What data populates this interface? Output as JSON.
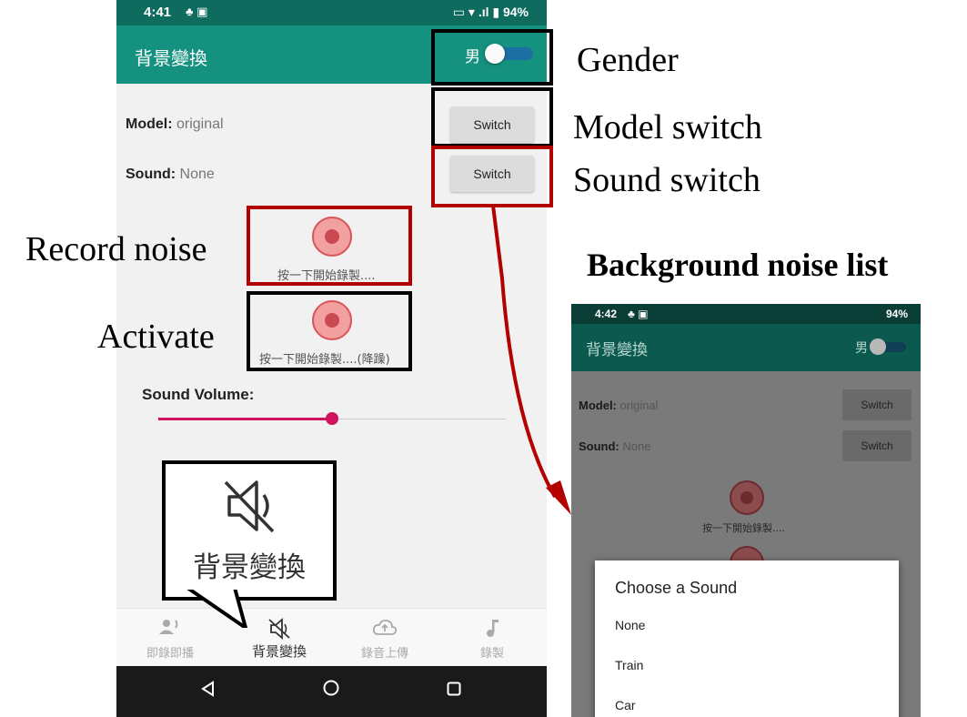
{
  "main_phone": {
    "status": {
      "time": "4:41",
      "icons_left": "♣ ▣",
      "icons_right": "▭ ▾ .ıl ▮",
      "battery": "94%"
    },
    "app_title": "背景變換",
    "gender_label": "男",
    "model": {
      "label": "Model:",
      "value": "original",
      "button": "Switch"
    },
    "sound": {
      "label": "Sound:",
      "value": "None",
      "button": "Switch"
    },
    "record_caption": "按一下開始錄製....",
    "activate_caption": "按一下開始錄製....(降躁)",
    "volume_label": "Sound Volume:",
    "volume_level": 0.5,
    "callout_label": "背景變換",
    "nav": [
      {
        "label": "即錄即播",
        "icon": "person-voice-icon"
      },
      {
        "label": "背景變換",
        "icon": "speaker-off-icon"
      },
      {
        "label": "錄音上傳",
        "icon": "cloud-upload-icon"
      },
      {
        "label": "錄製",
        "icon": "music-note-icon"
      }
    ]
  },
  "annotations": {
    "gender": "Gender",
    "model_switch": "Model switch",
    "sound_switch": "Sound switch",
    "record_noise": "Record noise",
    "activate": "Activate",
    "list_title": "Background noise list"
  },
  "second_phone": {
    "status": {
      "time": "4:42",
      "battery": "94%"
    },
    "app_title": "背景變換",
    "gender_label": "男",
    "model": {
      "label": "Model:",
      "value": "original",
      "button": "Switch"
    },
    "sound": {
      "label": "Sound:",
      "value": "None",
      "button": "Switch"
    },
    "record_caption": "按一下開始錄製....",
    "dialog": {
      "title": "Choose a Sound",
      "options": [
        "None",
        "Train",
        "Car"
      ]
    }
  },
  "colors": {
    "accent": "#14917f",
    "status": "#0e6b5e",
    "highlight_red": "#b30000",
    "slider": "#d0135c"
  }
}
